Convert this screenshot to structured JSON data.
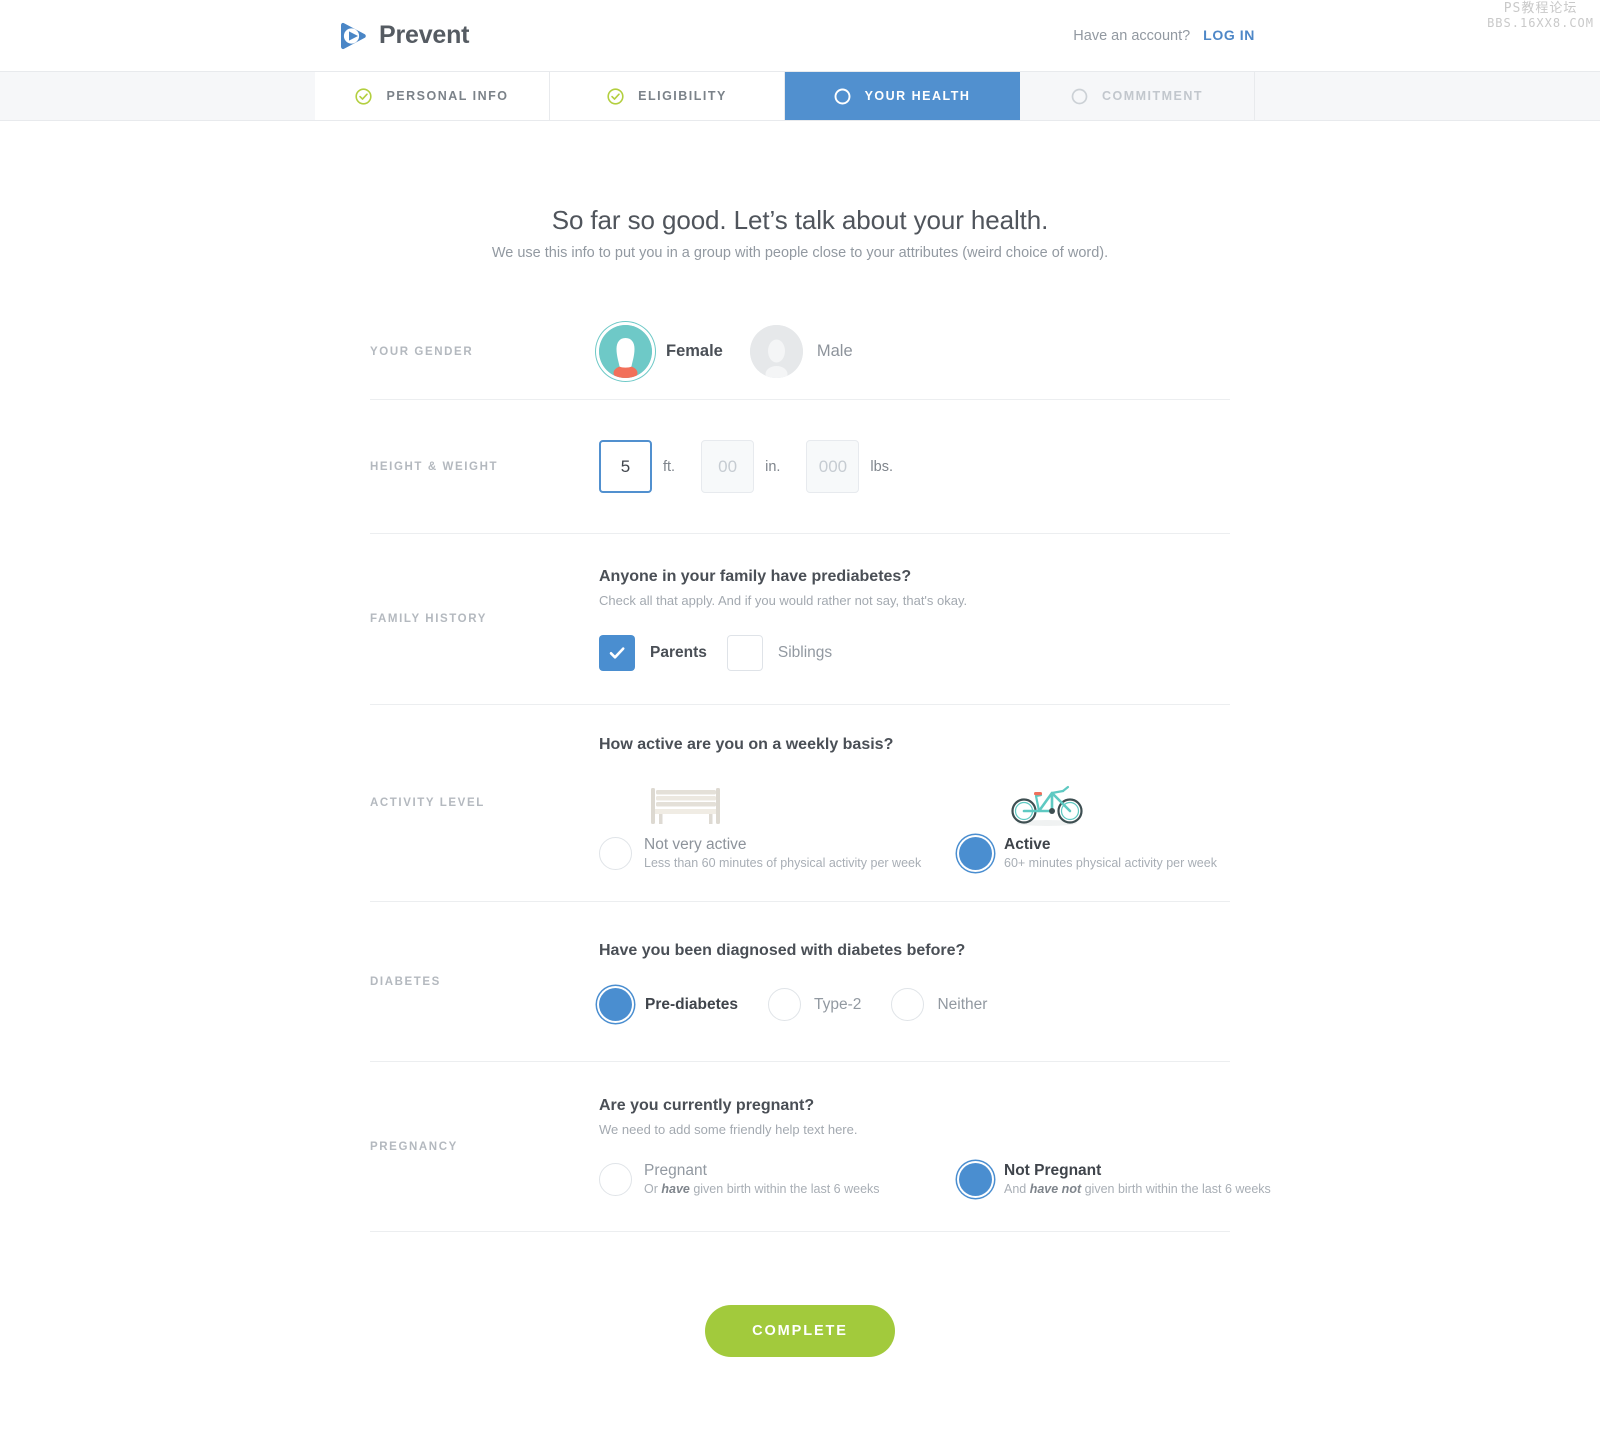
{
  "watermark": {
    "line1": "PS教程论坛",
    "line2": "BBS.16XX8.COM"
  },
  "header": {
    "brand": "Prevent",
    "logo_icon": "play-triangle-logo-icon",
    "account_prompt": "Have an account?",
    "login_label": "LOG IN"
  },
  "steps": [
    {
      "label": "PERSONAL INFO",
      "state": "done",
      "icon": "check-circle-icon"
    },
    {
      "label": "ELIGIBILITY",
      "state": "done",
      "icon": "check-circle-icon"
    },
    {
      "label": "YOUR HEALTH",
      "state": "current",
      "icon": "circle-icon"
    },
    {
      "label": "COMMITMENT",
      "state": "todo",
      "icon": "circle-icon"
    }
  ],
  "page": {
    "title": "So far so good. Let’s talk about your health.",
    "subtitle": "We use this info to put you in a group with people close to your attributes (weird choice of word)."
  },
  "gender": {
    "label": "YOUR GENDER",
    "options": [
      {
        "label": "Female",
        "selected": true,
        "icon": "female-avatar-icon"
      },
      {
        "label": "Male",
        "selected": false,
        "icon": "male-avatar-icon"
      }
    ]
  },
  "height_weight": {
    "label": "HEIGHT & WEIGHT",
    "feet": {
      "value": "5",
      "placeholder": "0",
      "unit": "ft.",
      "focused": true
    },
    "inches": {
      "value": "",
      "placeholder": "00",
      "unit": "in.",
      "focused": false
    },
    "pounds": {
      "value": "",
      "placeholder": "000",
      "unit": "lbs.",
      "focused": false
    }
  },
  "family_history": {
    "label": "FAMILY HISTORY",
    "question": "Anyone in your family have prediabetes?",
    "help": "Check all that apply. And if you would rather not say, that's okay.",
    "options": [
      {
        "label": "Parents",
        "checked": true,
        "icon": "checkmark-icon"
      },
      {
        "label": "Siblings",
        "checked": false,
        "icon": "empty-checkbox-icon"
      }
    ]
  },
  "activity": {
    "label": "ACTIVITY LEVEL",
    "question": "How active are you on a weekly basis?",
    "options": [
      {
        "title": "Not very active",
        "detail": "Less than 60 minutes of physical activity per week",
        "selected": false,
        "icon": "park-bench-icon"
      },
      {
        "title": "Active",
        "detail": "60+ minutes physical activity per week",
        "selected": true,
        "icon": "bicycle-icon"
      }
    ]
  },
  "diabetes": {
    "label": "DIABETES",
    "question": "Have you been diagnosed with diabetes before?",
    "options": [
      {
        "label": "Pre-diabetes",
        "selected": true
      },
      {
        "label": "Type-2",
        "selected": false
      },
      {
        "label": "Neither",
        "selected": false
      }
    ]
  },
  "pregnancy": {
    "label": "PREGNANCY",
    "question": "Are you currently pregnant?",
    "help": "We need to add some friendly help text here.",
    "options": [
      {
        "title": "Pregnant",
        "detail_pre": "Or ",
        "detail_em": "have",
        "detail_post": " given birth within the last 6 weeks",
        "selected": false
      },
      {
        "title": "Not Pregnant",
        "detail_pre": "And ",
        "detail_em": "have not",
        "detail_post": " given birth within the last 6 weeks",
        "selected": true
      }
    ]
  },
  "submit": {
    "label": "COMPLETE"
  },
  "colors": {
    "accent_blue": "#5190cf",
    "check_green": "#a2ca3c",
    "button_green": "#a2ca3c",
    "avatar_teal": "#6ec9c7",
    "avatar_shirt": "#f2705a",
    "bike_teal": "#5ec9c2"
  }
}
